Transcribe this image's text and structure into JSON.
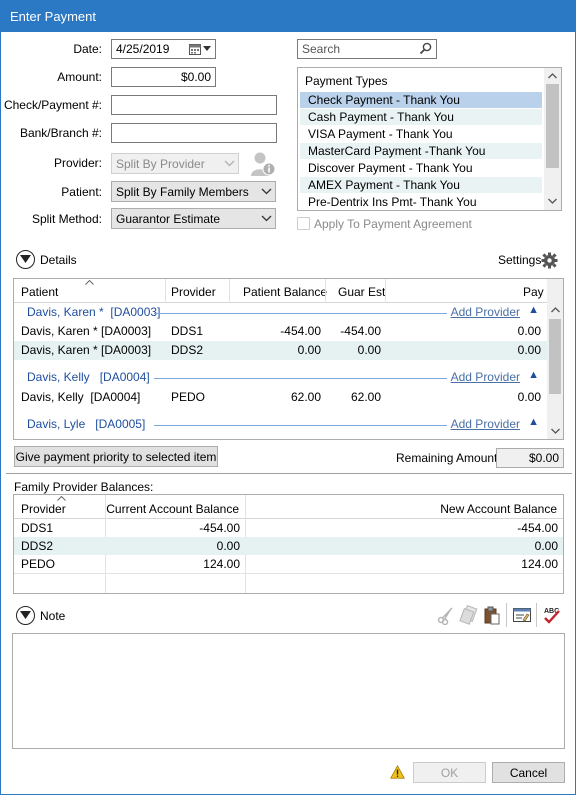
{
  "window": {
    "title": "Enter Payment"
  },
  "form": {
    "date_label": "Date:",
    "date_value": "4/25/2019",
    "amount_label": "Amount:",
    "amount_value": "$0.00",
    "check_label": "Check/Payment #:",
    "check_value": "",
    "bank_label": "Bank/Branch #:",
    "bank_value": "",
    "provider_label": "Provider:",
    "provider_value": "Split By Provider",
    "patient_label": "Patient:",
    "patient_value": "Split By Family Members",
    "split_label": "Split Method:",
    "split_value": "Guarantor Estimate"
  },
  "search": {
    "placeholder": "Search"
  },
  "payment_types": {
    "header": "Payment Types",
    "items": [
      "Check Payment - Thank You",
      "Cash Payment - Thank You",
      "VISA Payment - Thank You",
      "MasterCard Payment -Thank You",
      "Discover Payment - Thank You",
      "AMEX Payment - Thank You",
      "Pre-Dentrix Ins Pmt- Thank You"
    ],
    "selected_index": 0
  },
  "apply_agreement": {
    "label": "Apply To Payment Agreement",
    "checked": false
  },
  "details": {
    "title": "Details",
    "settings_label": "Settings",
    "columns": [
      "Patient",
      "Provider",
      "Patient Balance",
      "Guar Est",
      "Pay"
    ],
    "add_provider_label": "Add Provider",
    "groups": [
      {
        "name": "Davis, Karen *",
        "id": "[DA0003]",
        "rows": [
          {
            "patient": "Davis, Karen *",
            "id": "[DA0003]",
            "provider": "DDS1",
            "balance": "-454.00",
            "guar": "-454.00",
            "pay": "0.00"
          },
          {
            "patient": "Davis, Karen *",
            "id": "[DA0003]",
            "provider": "DDS2",
            "balance": "0.00",
            "guar": "0.00",
            "pay": "0.00"
          }
        ]
      },
      {
        "name": "Davis, Kelly",
        "id": "[DA0004]",
        "rows": [
          {
            "patient": "Davis, Kelly",
            "id": "[DA0004]",
            "provider": "PEDO",
            "balance": "62.00",
            "guar": "62.00",
            "pay": "0.00"
          }
        ]
      },
      {
        "name": "Davis, Lyle",
        "id": "[DA0005]",
        "rows": []
      }
    ]
  },
  "priority_button": "Give payment priority to selected item",
  "remaining": {
    "label": "Remaining Amount:",
    "value": "$0.00"
  },
  "family": {
    "title": "Family Provider Balances:",
    "columns": [
      "Provider",
      "Current Account Balance",
      "New Account Balance"
    ],
    "rows": [
      {
        "provider": "DDS1",
        "current": "-454.00",
        "new": "-454.00"
      },
      {
        "provider": "DDS2",
        "current": "0.00",
        "new": "0.00"
      },
      {
        "provider": "PEDO",
        "current": "124.00",
        "new": "124.00"
      }
    ]
  },
  "note": {
    "title": "Note",
    "value": ""
  },
  "buttons": {
    "ok": "OK",
    "cancel": "Cancel"
  },
  "colors": {
    "titlebar": "#2b78c5",
    "selected": "#b9d1ea",
    "alt_row": "#e6f2f2",
    "group_text": "#1f4e9e"
  }
}
